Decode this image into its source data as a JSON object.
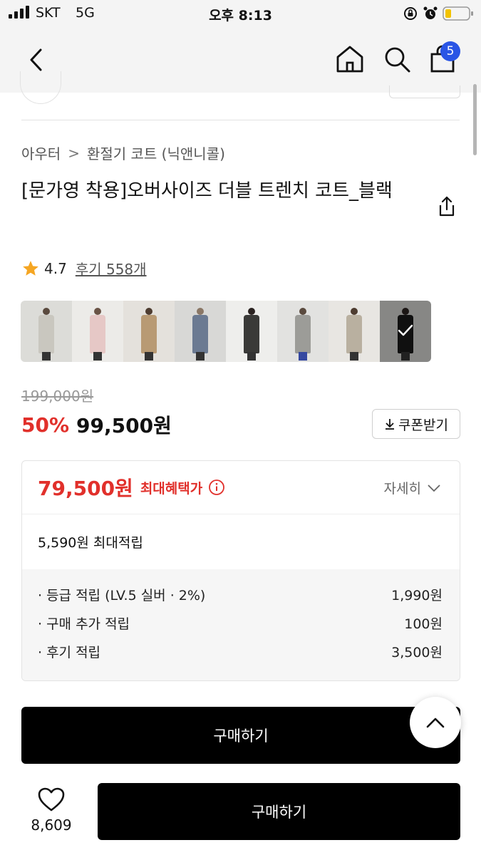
{
  "status_bar": {
    "carrier": "SKT",
    "network": "5G",
    "time": "오후 8:13"
  },
  "nav": {
    "cart_count": "5",
    "icons": [
      "back-chevron-icon",
      "home-icon",
      "search-icon",
      "shopping-bag-icon"
    ]
  },
  "breadcrumb": {
    "category": "아우터",
    "separator": ">",
    "subcategory": "환절기 코트 (닉앤니콜)"
  },
  "product": {
    "title": "[문가영 착용]오버사이즈 더블 트렌치 코트_블랙",
    "rating": "4.7",
    "reviews_label": "후기 558개",
    "thumbnail_count": 8,
    "selected_thumbnail": 8
  },
  "price": {
    "original": "199,000원",
    "discount": "50%",
    "sale": "99,500원",
    "coupon_label": "쿠폰받기"
  },
  "benefit": {
    "max_price": "79,500원",
    "max_label": "최대혜택가",
    "detail_label": "자세히",
    "points_total": "5,590원 최대적립",
    "items": [
      {
        "label": "· 등급 적립 (LV.5 실버 · 2%)",
        "value": "1,990원"
      },
      {
        "label": "· 구매 추가 적립",
        "value": "100원"
      },
      {
        "label": "· 후기 적립",
        "value": "3,500원"
      }
    ]
  },
  "actions": {
    "buy_label": "구매하기",
    "bottom_buy_label": "구매하기",
    "likes": "8,609"
  },
  "colors": {
    "accent_red": "#e1302b",
    "badge_blue": "#2a55e5",
    "button_black": "#000000"
  }
}
